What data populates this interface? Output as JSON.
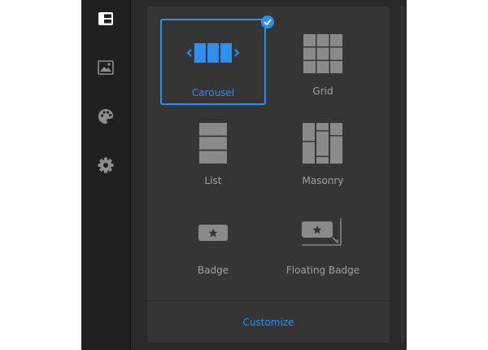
{
  "sidebar": {
    "items": [
      {
        "icon": "layout-icon",
        "active": true
      },
      {
        "icon": "image-icon",
        "active": false
      },
      {
        "icon": "palette-icon",
        "active": false
      },
      {
        "icon": "gear-icon",
        "active": false
      }
    ]
  },
  "layouts": {
    "selected": "Carousel",
    "items": [
      {
        "label": "Carousel",
        "icon": "carousel-icon"
      },
      {
        "label": "Grid",
        "icon": "grid-icon"
      },
      {
        "label": "List",
        "icon": "list-icon"
      },
      {
        "label": "Masonry",
        "icon": "masonry-icon"
      },
      {
        "label": "Badge",
        "icon": "badge-icon"
      },
      {
        "label": "Floating Badge",
        "icon": "floating-badge-icon"
      }
    ]
  },
  "footer": {
    "customize_label": "Customize"
  },
  "colors": {
    "accent": "#2e8ff0",
    "panel": "#353535",
    "sidebar": "#202020",
    "icon_gray": "#8a8a8a"
  }
}
